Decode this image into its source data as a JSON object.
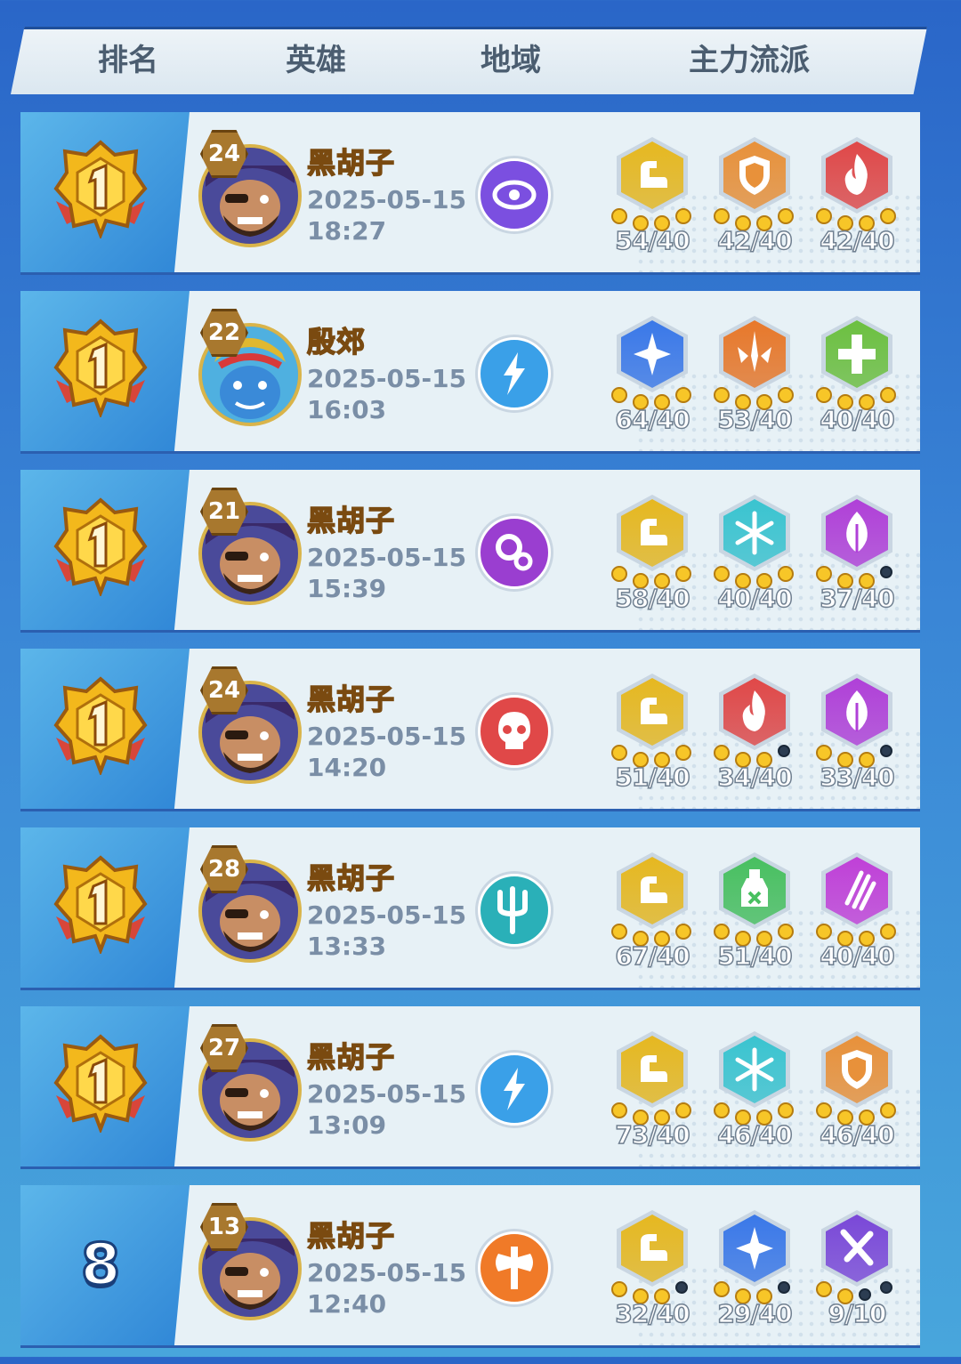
{
  "header": {
    "rank": "排名",
    "hero": "英雄",
    "region": "地域",
    "factions": "主力流派"
  },
  "rows": [
    {
      "rank": "1",
      "medal": "gold-medal-icon",
      "level": "24",
      "hero_name": "黑胡子",
      "avatar": "blackbeard",
      "date": "2025-05-15",
      "time": "18:27",
      "region": {
        "icon": "violet-eye-region-icon",
        "color": "#7b4fe0"
      },
      "factions": [
        {
          "icon": "muscle-icon",
          "color": "#e6b820",
          "score": "54/40",
          "pips": 3
        },
        {
          "icon": "shield-icon",
          "color": "#e8913a",
          "score": "42/40",
          "pips": 3
        },
        {
          "icon": "flame-icon",
          "color": "#e04848",
          "score": "42/40",
          "pips": 3
        }
      ]
    },
    {
      "rank": "1",
      "medal": "gold-medal-icon",
      "level": "22",
      "hero_name": "殷郊",
      "avatar": "yinjiao",
      "date": "2025-05-15",
      "time": "16:03",
      "region": {
        "icon": "lightning-region-icon",
        "color": "#3aa0e8"
      },
      "factions": [
        {
          "icon": "sparkle-icon",
          "color": "#3a78e8",
          "score": "64/40",
          "pips": 3
        },
        {
          "icon": "sword-burst-icon",
          "color": "#e8782a",
          "score": "53/40",
          "pips": 3
        },
        {
          "icon": "plus-icon",
          "color": "#6cc040",
          "score": "40/40",
          "pips": 3
        }
      ]
    },
    {
      "rank": "1",
      "medal": "gold-medal-icon",
      "level": "21",
      "hero_name": "黑胡子",
      "avatar": "blackbeard",
      "date": "2025-05-15",
      "time": "15:39",
      "region": {
        "icon": "gears-region-icon",
        "color": "#9a3ed0"
      },
      "factions": [
        {
          "icon": "muscle-icon",
          "color": "#e6b820",
          "score": "58/40",
          "pips": 3
        },
        {
          "icon": "snowflake-icon",
          "color": "#3ac4d0",
          "score": "40/40",
          "pips": 3
        },
        {
          "icon": "leaf-icon",
          "color": "#b040d8",
          "score": "37/40",
          "pips": 2
        }
      ]
    },
    {
      "rank": "1",
      "medal": "gold-medal-icon",
      "level": "24",
      "hero_name": "黑胡子",
      "avatar": "blackbeard",
      "date": "2025-05-15",
      "time": "14:20",
      "region": {
        "icon": "skull-region-icon",
        "color": "#e04848"
      },
      "factions": [
        {
          "icon": "muscle-icon",
          "color": "#e6b820",
          "score": "51/40",
          "pips": 3
        },
        {
          "icon": "flame-icon",
          "color": "#e04848",
          "score": "34/40",
          "pips": 2
        },
        {
          "icon": "leaf-icon",
          "color": "#b040d8",
          "score": "33/40",
          "pips": 2
        }
      ]
    },
    {
      "rank": "1",
      "medal": "gold-medal-icon",
      "level": "28",
      "hero_name": "黑胡子",
      "avatar": "blackbeard",
      "date": "2025-05-15",
      "time": "13:33",
      "region": {
        "icon": "trident-region-icon",
        "color": "#2ab0b8"
      },
      "factions": [
        {
          "icon": "muscle-icon",
          "color": "#e6b820",
          "score": "67/40",
          "pips": 3
        },
        {
          "icon": "poison-bottle-icon",
          "color": "#48c060",
          "score": "51/40",
          "pips": 3
        },
        {
          "icon": "claw-icon",
          "color": "#c040d8",
          "score": "40/40",
          "pips": 3
        }
      ]
    },
    {
      "rank": "1",
      "medal": "gold-medal-icon",
      "level": "27",
      "hero_name": "黑胡子",
      "avatar": "blackbeard",
      "date": "2025-05-15",
      "time": "13:09",
      "region": {
        "icon": "lightning-region-icon",
        "color": "#3aa0e8"
      },
      "factions": [
        {
          "icon": "muscle-icon",
          "color": "#e6b820",
          "score": "73/40",
          "pips": 3
        },
        {
          "icon": "snowflake-icon",
          "color": "#3ac4d0",
          "score": "46/40",
          "pips": 3
        },
        {
          "icon": "shield-icon",
          "color": "#e8913a",
          "score": "46/40",
          "pips": 3
        }
      ]
    },
    {
      "rank": "8",
      "medal": "",
      "level": "13",
      "hero_name": "黑胡子",
      "avatar": "blackbeard",
      "date": "2025-05-15",
      "time": "12:40",
      "region": {
        "icon": "axe-region-icon",
        "color": "#f07a28"
      },
      "factions": [
        {
          "icon": "muscle-icon",
          "color": "#e6b820",
          "score": "32/40",
          "pips": 2
        },
        {
          "icon": "sparkle-icon",
          "color": "#3a78e8",
          "score": "29/40",
          "pips": 2
        },
        {
          "icon": "crossed-swords-icon",
          "color": "#7a48d8",
          "score": "9/10",
          "pips": 1
        }
      ]
    }
  ]
}
